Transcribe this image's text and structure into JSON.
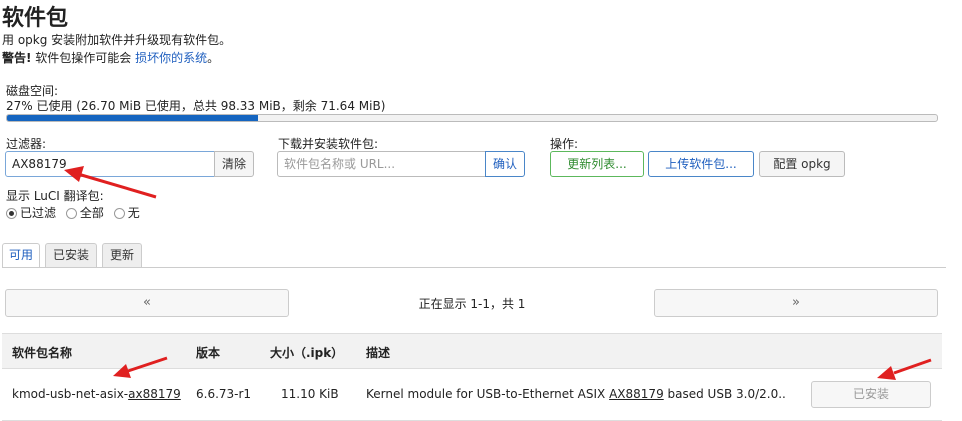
{
  "header": {
    "title": "软件包",
    "desc1": "用 opkg 安装附加软件并升级现有软件包。",
    "warn_bold": "警告!",
    "warn_text": " 软件包操作可能会 ",
    "warn_link": "损坏你的系统",
    "warn_end": "。"
  },
  "disk": {
    "label": "磁盘空间:",
    "usage_text": "27% 已使用 (26.70 MiB 已使用，总共 98.33 MiB，剩余 71.64 MiB)",
    "percent": 27
  },
  "filter": {
    "label": "过滤器:",
    "value": "AX88179",
    "clear_label": "清除"
  },
  "download": {
    "label": "下载并安装软件包:",
    "placeholder": "软件包名称或 URL...",
    "ok_label": "确认"
  },
  "actions": {
    "label": "操作:",
    "update_label": "更新列表...",
    "upload_label": "上传软件包...",
    "config_label": "配置 opkg"
  },
  "translation": {
    "label": "显示 LuCI 翻译包:",
    "options": [
      "已过滤",
      "全部",
      "无"
    ],
    "selected": 0
  },
  "tabs": [
    "可用",
    "已安装",
    "更新"
  ],
  "active_tab": 0,
  "pager": {
    "prev": "«",
    "next": "»",
    "status": "正在显示 1-1，共 1"
  },
  "table": {
    "headers": [
      "软件包名称",
      "版本",
      "大小（.ipk）",
      "描述"
    ],
    "rows": [
      {
        "name_prefix": "kmod-usb-net-asix-",
        "name_match": "ax88179",
        "version": "6.6.73-r1",
        "size": "11.10 KiB",
        "desc_prefix": "Kernel module for USB-to-Ethernet ASIX ",
        "desc_match": "AX88179",
        "desc_suffix": " based USB 3.0/2.0...",
        "action_label": "已安装"
      }
    ]
  },
  "colors": {
    "accent": "#1f5fbf",
    "bar_fill": "#1565c0",
    "arrow": "#e02020",
    "green": "#2e8b2e"
  }
}
